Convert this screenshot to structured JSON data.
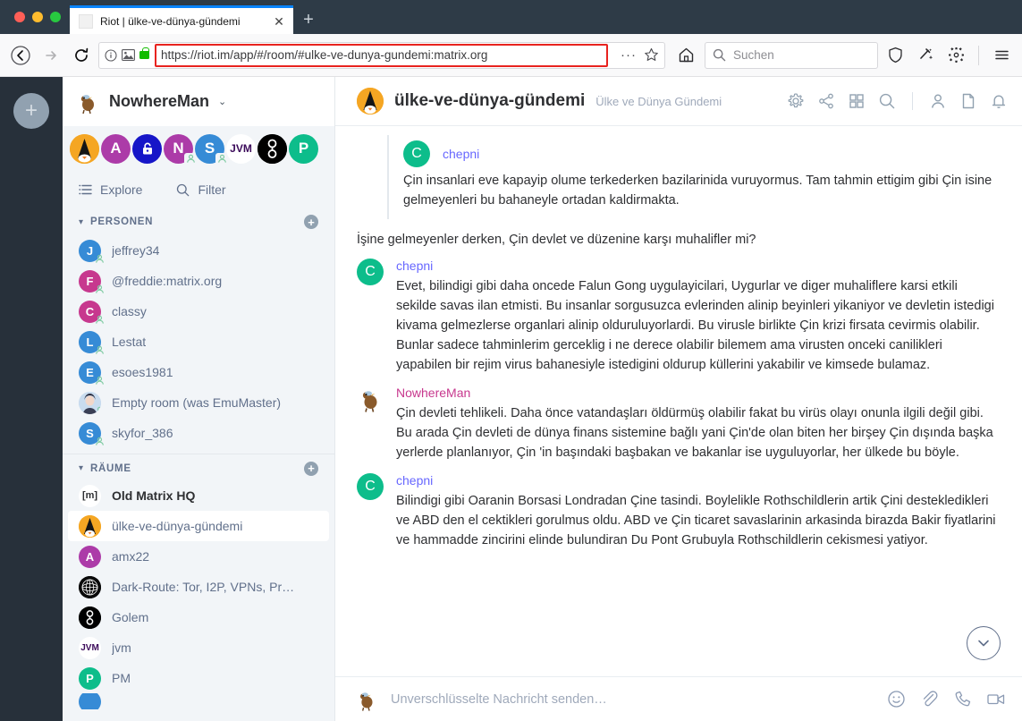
{
  "browser": {
    "tab": {
      "title": "Riot | ülke-ve-dünya-gündemi",
      "close_label": "✕",
      "favicon": "page-icon"
    },
    "newtab_label": "+",
    "nav": {
      "back": "←",
      "forward": "→",
      "reload": "⟳",
      "home": "home-icon"
    },
    "url": {
      "scheme": "https://",
      "host": "riot.im",
      "path": "/app/#/room/#ulke-ve-dunya-gundemi:matrix.org"
    },
    "url_full": "https://riot.im/app/#/room/#ulke-ve-dunya-gundemi:matrix.org",
    "url_highlight_color": "#e8231f",
    "identity_icons": [
      "info-icon",
      "image-permission-icon",
      "lock-icon"
    ],
    "page_actions": {
      "more": "…",
      "bookmark": "☆"
    },
    "search": {
      "placeholder": "Suchen"
    },
    "toolbar_icons": [
      "shield-icon",
      "pocket-icon",
      "gear-icon",
      "hamburger-menu-icon"
    ]
  },
  "app": {
    "groupbar": {
      "add_label": "+"
    },
    "user": {
      "name": "NowhereMan",
      "avatar": "nowhereman-bird-avatar",
      "chevron": "⌄"
    },
    "avatar_row": [
      {
        "label": "A",
        "bg": "#f5a623",
        "kind": "room",
        "art": "penguin"
      },
      {
        "label": "A",
        "bg": "#ac3ba8",
        "kind": "room"
      },
      {
        "label": "",
        "bg": "#1616c8",
        "kind": "room",
        "art": "lock"
      },
      {
        "label": "N",
        "bg": "#ac3ba8",
        "kind": "dm"
      },
      {
        "label": "S",
        "bg": "#368bd6",
        "kind": "dm"
      },
      {
        "label": "JVM",
        "bg": "#ffffff",
        "fg": "#3b0a5a",
        "kind": "room"
      },
      {
        "label": "",
        "bg": "#000000",
        "kind": "room",
        "art": "golem"
      },
      {
        "label": "P",
        "bg": "#0dbd8b",
        "kind": "room"
      }
    ],
    "explore": {
      "label": "Explore",
      "icon": "list-icon"
    },
    "filter": {
      "label": "Filter",
      "icon": "search-icon"
    },
    "sections": [
      {
        "id": "personen",
        "title": "PERSONEN",
        "add_label": "+",
        "items": [
          {
            "name": "jeffrey34",
            "initial": "J",
            "bg": "#368bd6",
            "dm": true
          },
          {
            "name": "@freddie:matrix.org",
            "initial": "F",
            "bg": "#c7388e",
            "dm": true
          },
          {
            "name": "classy",
            "initial": "C",
            "bg": "#c7388e",
            "dm": true
          },
          {
            "name": "Lestat",
            "initial": "L",
            "bg": "#368bd6",
            "dm": true
          },
          {
            "name": "esoes1981",
            "initial": "E",
            "bg": "#368bd6",
            "dm": true
          },
          {
            "name": "Empty room (was EmuMaster)",
            "initial": "",
            "bg": "#b8cfe8",
            "dm": true,
            "art": "photo"
          },
          {
            "name": "skyfor_386",
            "initial": "S",
            "bg": "#368bd6",
            "dm": true
          }
        ]
      },
      {
        "id": "raeume",
        "title": "RÄUME",
        "add_label": "+",
        "items": [
          {
            "name": "Old Matrix HQ",
            "initial": "m",
            "bg": "#ffffff",
            "fg": "#2e2f32",
            "bold": true
          },
          {
            "name": "ülke-ve-dünya-gündemi",
            "initial": "A",
            "bg": "#f5a623",
            "art": "penguin",
            "selected": true
          },
          {
            "name": "amx22",
            "initial": "A",
            "bg": "#ac3ba8"
          },
          {
            "name": "Dark-Route: Tor, I2P, VPNs, Pr…",
            "initial": "",
            "bg": "#000000",
            "art": "globe"
          },
          {
            "name": "Golem",
            "initial": "",
            "bg": "#000000",
            "art": "golem"
          },
          {
            "name": "jvm",
            "initial": "JVM",
            "bg": "#ffffff",
            "fg": "#3b0a5a"
          },
          {
            "name": "PM",
            "initial": "P",
            "bg": "#0dbd8b"
          },
          {
            "name": "",
            "initial": "",
            "bg": "#368bd6",
            "partial": true
          }
        ]
      }
    ],
    "room": {
      "name": "ülke-ve-dünya-gündemi",
      "topic": "Ülke ve Dünya Gündemi",
      "avatar_bg": "#f5a623",
      "header_icons": [
        "gear-icon",
        "share-icon",
        "apps-icon",
        "search-icon",
        "members-icon",
        "files-icon",
        "notifications-icon"
      ]
    },
    "timeline": {
      "quote": {
        "sender": "chepni",
        "sender_color": "#6767ff",
        "avatar_initial": "C",
        "avatar_bg": "#0dbd8b",
        "text": "Çin insanlari eve kapayip olume terkederken bazilarinida vuruyormus. Tam tahmin ettigim gibi Çin isine gelmeyenleri bu bahaneyle ortadan kaldirmakta."
      },
      "quote_reply_text": "İşine gelmeyenler derken, Çin devlet ve düzenine karşı muhalifler mi?",
      "events": [
        {
          "sender": "chepni",
          "sender_color": "#6767ff",
          "avatar_initial": "C",
          "avatar_bg": "#0dbd8b",
          "text": "Evet, bilindigi gibi daha oncede Falun Gong uygulayicilari, Uygurlar ve diger muhaliflere karsi etkili sekilde savas ilan etmisti. Bu insanlar sorgusuzca evlerinden alinip beyinleri yikaniyor ve devletin istedigi kivama gelmezlerse organlari alinip olduruluyorlardi. Bu virusle birlikte Çin krizi firsata cevirmis olabilir. Bunlar sadece tahminlerim gerceklig i ne derece olabilir bilemem ama virusten onceki canilikleri yapabilen bir rejim virus bahanesiyle istedigini oldurup küllerini yakabilir ve kimsede bulamaz."
        },
        {
          "sender": "NowhereMan",
          "sender_color": "#c7388e",
          "avatar_initial": "",
          "avatar_bg": "#ffffff",
          "avatar_art": "bird",
          "text": "Çin devleti tehlikeli. Daha  önce vatandaşları öldürmüş olabilir fakat bu virüs olayı onunla ilgili değil gibi. Bu arada Çin devleti de dünya finans sistemine bağlı yani Çin'de olan biten her birşey Çin dışında başka yerlerde planlanıyor, Çin 'in başındaki başbakan ve bakanlar ise uyguluyorlar, her ülkede bu böyle."
        },
        {
          "sender": "chepni",
          "sender_color": "#6767ff",
          "avatar_initial": "C",
          "avatar_bg": "#0dbd8b",
          "text": "Bilindigi gibi Oaranin Borsasi Londradan Çine tasindi. Boylelikle Rothschildlerin artik Çini destekledikleri ve ABD den el cektikleri gorulmus oldu. ABD ve Çin ticaret savaslarinin arkasinda birazda Bakir fiyatlarini ve hammadde zincirini elinde bulundiran Du Pont Grubuyla Rothschildlerin cekismesi yatiyor."
        }
      ],
      "jump_to_bottom": "chevron-down-icon"
    },
    "composer": {
      "placeholder": "Unverschlüsselte Nachricht senden…",
      "icons": [
        "emoji-icon",
        "attachment-icon",
        "voice-call-icon",
        "video-call-icon"
      ]
    }
  }
}
